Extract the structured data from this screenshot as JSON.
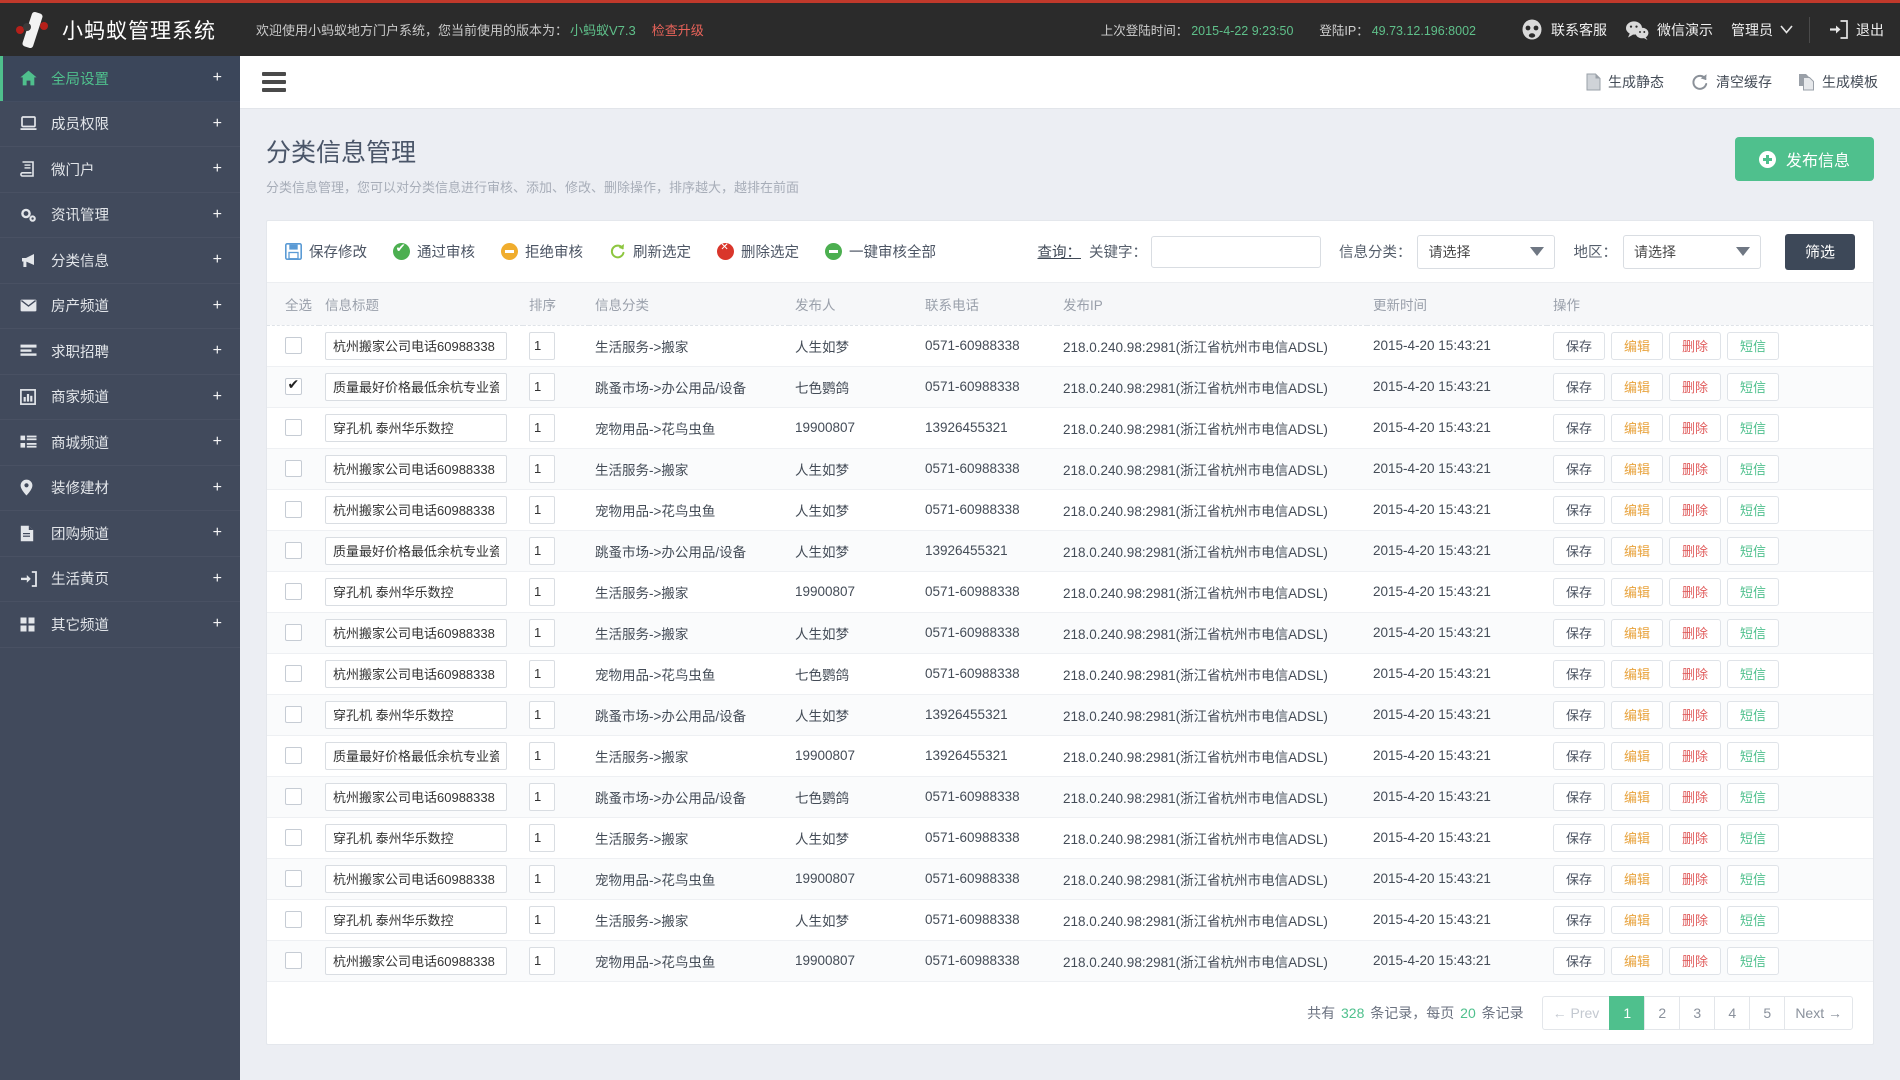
{
  "brand": {
    "title": "小蚂蚁管理系统",
    "welcome_prefix": "欢迎使用小蚂蚁地方门户系统，您当前使用的版本为：",
    "version": "小蚂蚁V7.3",
    "upgrade_link": "检查升级"
  },
  "topbar": {
    "last_login_label": "上次登陆时间：",
    "last_login_value": "2015-4-22  9:23:50",
    "login_ip_label": "登陆IP：",
    "login_ip_value": "49.73.12.196:8002",
    "support": "联系客服",
    "wechat_demo": "微信演示",
    "user": "管理员",
    "logout": "退出"
  },
  "sidebar": {
    "items": [
      {
        "label": "全局设置",
        "icon": "home-icon",
        "expand": "+",
        "active": true
      },
      {
        "label": "成员权限",
        "icon": "monitor-icon",
        "expand": "+",
        "active": false
      },
      {
        "label": "微门户",
        "icon": "book-icon",
        "expand": "+",
        "active": false
      },
      {
        "label": "资讯管理",
        "icon": "gears-icon",
        "expand": "+",
        "active": false
      },
      {
        "label": "分类信息",
        "icon": "megaphone-icon",
        "expand": "+",
        "active": false
      },
      {
        "label": "房产频道",
        "icon": "envelope-icon",
        "expand": "+",
        "active": false
      },
      {
        "label": "求职招聘",
        "icon": "list-icon",
        "expand": "+",
        "active": false
      },
      {
        "label": "商家频道",
        "icon": "chart-icon",
        "expand": "+",
        "active": false
      },
      {
        "label": "商城频道",
        "icon": "grid-list-icon",
        "expand": "+",
        "active": false
      },
      {
        "label": "装修建材",
        "icon": "map-pin-icon",
        "expand": "+",
        "active": false
      },
      {
        "label": "团购频道",
        "icon": "file-icon",
        "expand": "+",
        "active": false
      },
      {
        "label": "生活黄页",
        "icon": "signin-icon",
        "expand": "+",
        "active": false
      },
      {
        "label": "其它频道",
        "icon": "th-large-icon",
        "expand": "+",
        "active": false
      }
    ]
  },
  "ribbon": {
    "menu_toggle": "hamburger-icon",
    "actions": [
      {
        "label": "生成静态",
        "icon": "file-static-icon"
      },
      {
        "label": "清空缓存",
        "icon": "refresh-icon"
      },
      {
        "label": "生成模板",
        "icon": "copy-icon"
      }
    ]
  },
  "page": {
    "title": "分类信息管理",
    "subtitle": "分类信息管理，您可以对分类信息进行审核、添加、修改、删除操作，排序越大，越排在前面",
    "publish_button": "发布信息"
  },
  "toolbar": {
    "buttons": [
      {
        "label": "保存修改",
        "icon": "save-icon",
        "color": "#5b9bd5"
      },
      {
        "label": "通过审核",
        "icon": "check-icon",
        "color": "#4caf50"
      },
      {
        "label": "拒绝审核",
        "icon": "minus-icon",
        "color": "#f0ad2e"
      },
      {
        "label": "刷新选定",
        "icon": "refresh-icon",
        "color": "#8dc63f"
      },
      {
        "label": "删除选定",
        "icon": "cross-icon",
        "color": "#d9362b"
      },
      {
        "label": "一键审核全部",
        "icon": "minus-icon",
        "color": "#4caf50"
      }
    ]
  },
  "filters": {
    "query_label": "查询：",
    "keyword_label": "关键字：",
    "keyword_value": "",
    "keyword_placeholder": "",
    "category_label": "信息分类：",
    "category_value": "请选择",
    "region_label": "地区：",
    "region_value": "请选择",
    "submit_label": "筛选"
  },
  "table": {
    "columns": [
      "全选",
      "信息标题",
      "排序",
      "信息分类",
      "发布人",
      "联系电话",
      "发布IP",
      "更新时间",
      "操作"
    ],
    "row_actions": [
      "保存",
      "编辑",
      "删除",
      "短信"
    ],
    "rows": [
      {
        "checked": false,
        "title": "杭州搬家公司电话60988338",
        "order": "1",
        "category": "生活服务->搬家",
        "publisher": "人生如梦",
        "phone": "0571-60988338",
        "ip": "218.0.240.98:2981(浙江省杭州市电信ADSL)",
        "updated": "2015-4-20 15:43:21"
      },
      {
        "checked": true,
        "title": "质量最好价格最低余杭专业瓷...",
        "order": "1",
        "category": "跳蚤市场->办公用品/设备",
        "publisher": "七色鹦鸽",
        "phone": "0571-60988338",
        "ip": "218.0.240.98:2981(浙江省杭州市电信ADSL)",
        "updated": "2015-4-20 15:43:21"
      },
      {
        "checked": false,
        "title": "穿孔机 泰州华乐数控",
        "order": "1",
        "category": "宠物用品->花鸟虫鱼",
        "publisher": "19900807",
        "phone": "13926455321",
        "ip": "218.0.240.98:2981(浙江省杭州市电信ADSL)",
        "updated": "2015-4-20 15:43:21"
      },
      {
        "checked": false,
        "title": "杭州搬家公司电话60988338",
        "order": "1",
        "category": "生活服务->搬家",
        "publisher": "人生如梦",
        "phone": "0571-60988338",
        "ip": "218.0.240.98:2981(浙江省杭州市电信ADSL)",
        "updated": "2015-4-20 15:43:21"
      },
      {
        "checked": false,
        "title": "杭州搬家公司电话60988338",
        "order": "1",
        "category": "宠物用品->花鸟虫鱼",
        "publisher": "人生如梦",
        "phone": "0571-60988338",
        "ip": "218.0.240.98:2981(浙江省杭州市电信ADSL)",
        "updated": "2015-4-20 15:43:21"
      },
      {
        "checked": false,
        "title": "质量最好价格最低余杭专业瓷...",
        "order": "1",
        "category": "跳蚤市场->办公用品/设备",
        "publisher": "人生如梦",
        "phone": "13926455321",
        "ip": "218.0.240.98:2981(浙江省杭州市电信ADSL)",
        "updated": "2015-4-20 15:43:21"
      },
      {
        "checked": false,
        "title": "穿孔机 泰州华乐数控",
        "order": "1",
        "category": "生活服务->搬家",
        "publisher": "19900807",
        "phone": "0571-60988338",
        "ip": "218.0.240.98:2981(浙江省杭州市电信ADSL)",
        "updated": "2015-4-20 15:43:21"
      },
      {
        "checked": false,
        "title": "杭州搬家公司电话60988338",
        "order": "1",
        "category": "生活服务->搬家",
        "publisher": "人生如梦",
        "phone": "0571-60988338",
        "ip": "218.0.240.98:2981(浙江省杭州市电信ADSL)",
        "updated": "2015-4-20 15:43:21"
      },
      {
        "checked": false,
        "title": "杭州搬家公司电话60988338",
        "order": "1",
        "category": "宠物用品->花鸟虫鱼",
        "publisher": "七色鹦鸽",
        "phone": "0571-60988338",
        "ip": "218.0.240.98:2981(浙江省杭州市电信ADSL)",
        "updated": "2015-4-20 15:43:21"
      },
      {
        "checked": false,
        "title": "穿孔机 泰州华乐数控",
        "order": "1",
        "category": "跳蚤市场->办公用品/设备",
        "publisher": "人生如梦",
        "phone": "13926455321",
        "ip": "218.0.240.98:2981(浙江省杭州市电信ADSL)",
        "updated": "2015-4-20 15:43:21"
      },
      {
        "checked": false,
        "title": "质量最好价格最低余杭专业瓷...",
        "order": "1",
        "category": "生活服务->搬家",
        "publisher": "19900807",
        "phone": "13926455321",
        "ip": "218.0.240.98:2981(浙江省杭州市电信ADSL)",
        "updated": "2015-4-20 15:43:21"
      },
      {
        "checked": false,
        "title": "杭州搬家公司电话60988338",
        "order": "1",
        "category": "跳蚤市场->办公用品/设备",
        "publisher": "七色鹦鸽",
        "phone": "0571-60988338",
        "ip": "218.0.240.98:2981(浙江省杭州市电信ADSL)",
        "updated": "2015-4-20 15:43:21"
      },
      {
        "checked": false,
        "title": "穿孔机 泰州华乐数控",
        "order": "1",
        "category": "生活服务->搬家",
        "publisher": "人生如梦",
        "phone": "0571-60988338",
        "ip": "218.0.240.98:2981(浙江省杭州市电信ADSL)",
        "updated": "2015-4-20 15:43:21"
      },
      {
        "checked": false,
        "title": "杭州搬家公司电话60988338",
        "order": "1",
        "category": "宠物用品->花鸟虫鱼",
        "publisher": "19900807",
        "phone": "0571-60988338",
        "ip": "218.0.240.98:2981(浙江省杭州市电信ADSL)",
        "updated": "2015-4-20 15:43:21"
      },
      {
        "checked": false,
        "title": "穿孔机 泰州华乐数控",
        "order": "1",
        "category": "生活服务->搬家",
        "publisher": "人生如梦",
        "phone": "0571-60988338",
        "ip": "218.0.240.98:2981(浙江省杭州市电信ADSL)",
        "updated": "2015-4-20 15:43:21"
      },
      {
        "checked": false,
        "title": "杭州搬家公司电话60988338",
        "order": "1",
        "category": "宠物用品->花鸟虫鱼",
        "publisher": "19900807",
        "phone": "0571-60988338",
        "ip": "218.0.240.98:2981(浙江省杭州市电信ADSL)",
        "updated": "2015-4-20 15:43:21"
      }
    ]
  },
  "pagination": {
    "total_prefix": "共有",
    "total_count": "328",
    "total_mid": "条记录，每页",
    "per_page": "20",
    "total_suffix": "条记录",
    "prev_label": "← Prev",
    "next_label": "Next →",
    "pages": [
      "1",
      "2",
      "3",
      "4",
      "5"
    ],
    "current_page": "1"
  }
}
